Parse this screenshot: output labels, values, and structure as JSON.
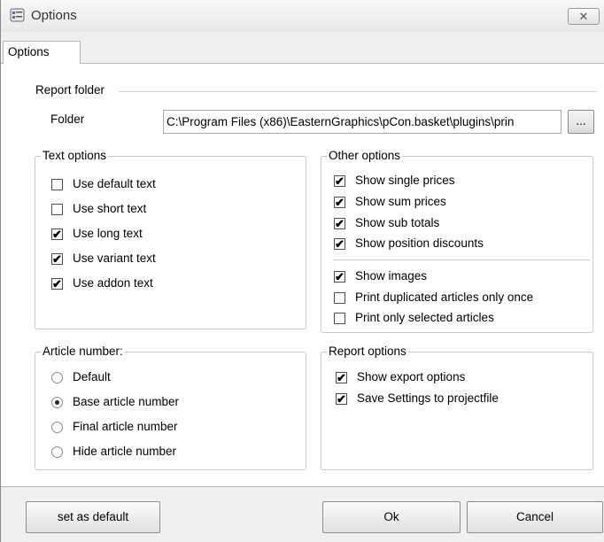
{
  "window": {
    "title": "Options",
    "close_glyph": "✕"
  },
  "tabs": [
    {
      "label": "Options",
      "active": true
    }
  ],
  "report": {
    "section_label": "Report folder",
    "folder_label": "Folder",
    "folder_value": "C:\\Program Files (x86)\\EasternGraphics\\pCon.basket\\plugins\\prin",
    "browse_label": "..."
  },
  "text_options": {
    "title": "Text options",
    "items": [
      {
        "label": "Use default text",
        "checked": false
      },
      {
        "label": "Use short text",
        "checked": false
      },
      {
        "label": "Use long text",
        "checked": true
      },
      {
        "label": "Use variant text",
        "checked": true
      },
      {
        "label": "Use addon text",
        "checked": true
      }
    ]
  },
  "other_options": {
    "title": "Other options",
    "items": [
      {
        "label": "Show single prices",
        "checked": true
      },
      {
        "label": "Show sum prices",
        "checked": true
      },
      {
        "label": "Show sub totals",
        "checked": true
      },
      {
        "label": "Show position discounts",
        "checked": true
      },
      {
        "label": "Show images",
        "checked": true
      },
      {
        "label": "Print duplicated articles only once",
        "checked": false
      },
      {
        "label": "Print only selected articles",
        "checked": false
      }
    ]
  },
  "article_number": {
    "title": "Article number:",
    "items": [
      {
        "label": "Default",
        "selected": false
      },
      {
        "label": "Base article number",
        "selected": true
      },
      {
        "label": "Final article number",
        "selected": false
      },
      {
        "label": "Hide article number",
        "selected": false
      }
    ]
  },
  "report_options": {
    "title": "Report options",
    "items": [
      {
        "label": "Show export options",
        "checked": true
      },
      {
        "label": "Save Settings to projectfile",
        "checked": true
      }
    ]
  },
  "footer": {
    "set_default_label": "set as default",
    "ok_label": "Ok",
    "cancel_label": "Cancel"
  },
  "icons": {
    "app": "options-window-icon",
    "check": "✔"
  }
}
